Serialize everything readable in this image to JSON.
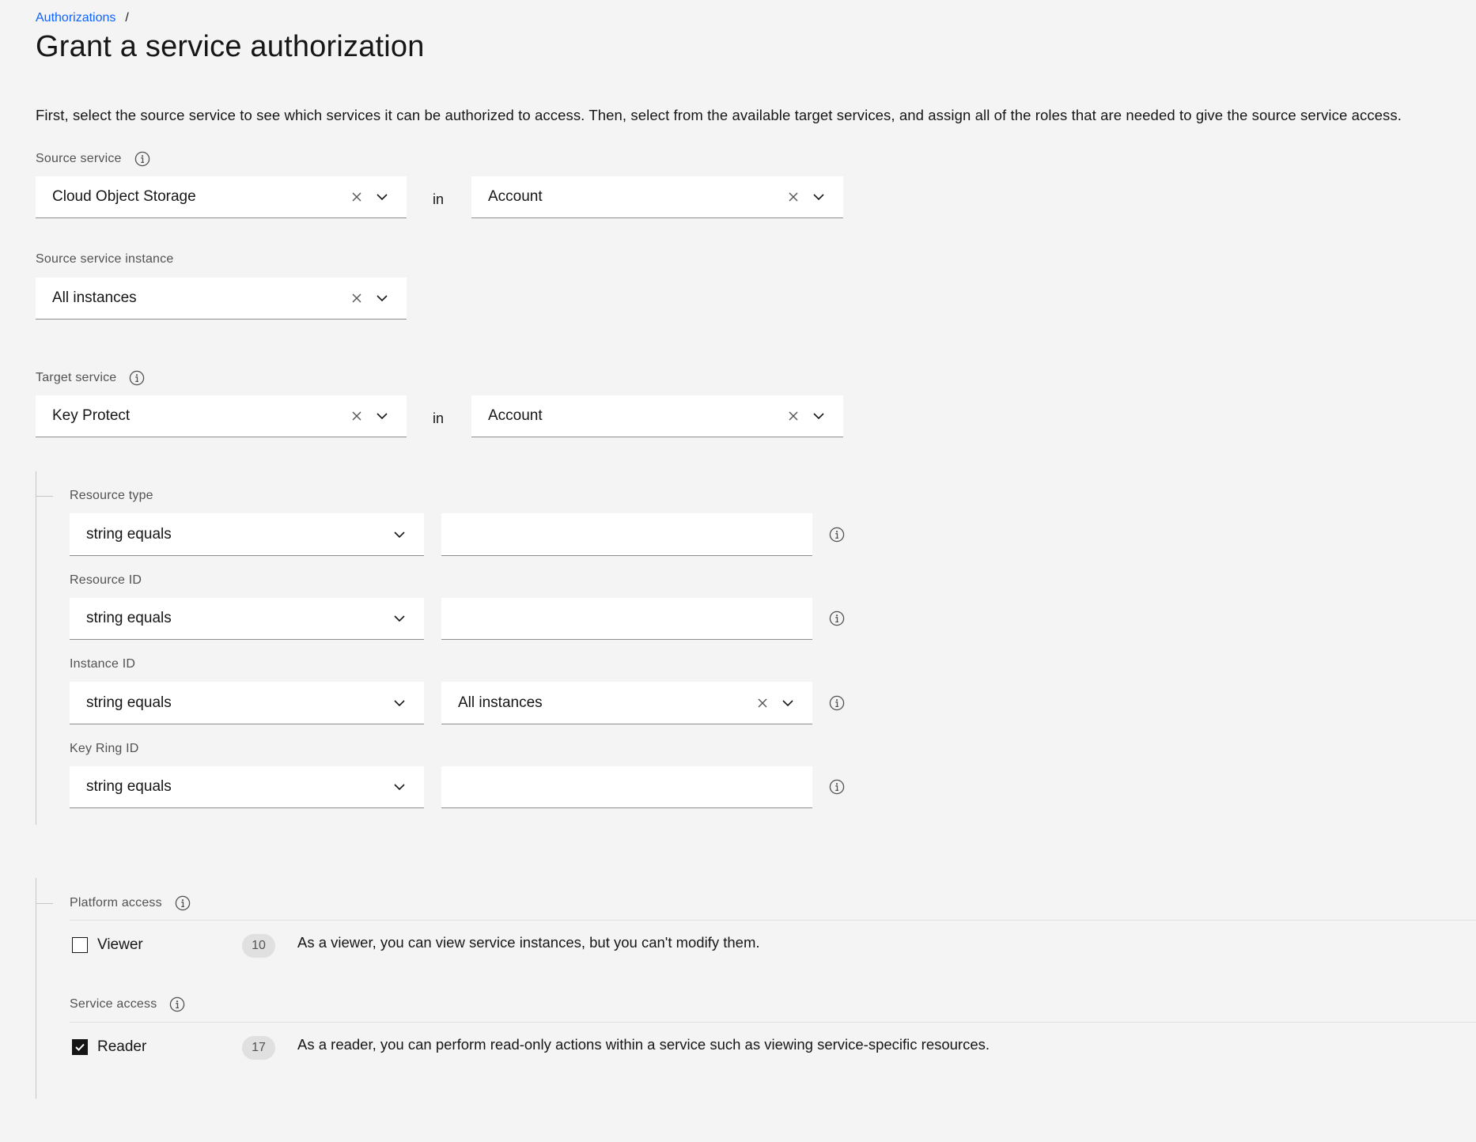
{
  "breadcrumb": {
    "link": "Authorizations",
    "separator": "/"
  },
  "page": {
    "title": "Grant a service authorization",
    "intro": "First, select the source service to see which services it can be authorized to access. Then, select from the available target services, and assign all of the roles that are needed to give the source service access."
  },
  "source": {
    "label": "Source service",
    "service_value": "Cloud Object Storage",
    "in_label": "in",
    "scope_value": "Account",
    "instance_label": "Source service instance",
    "instance_value": "All instances"
  },
  "target": {
    "label": "Target service",
    "service_value": "Key Protect",
    "in_label": "in",
    "scope_value": "Account"
  },
  "attributes": [
    {
      "label": "Resource type",
      "operator": "string equals",
      "value": ""
    },
    {
      "label": "Resource ID",
      "operator": "string equals",
      "value": ""
    },
    {
      "label": "Instance ID",
      "operator": "string equals",
      "value": "All instances"
    },
    {
      "label": "Key Ring ID",
      "operator": "string equals",
      "value": ""
    }
  ],
  "platform_access": {
    "label": "Platform access",
    "roles": [
      {
        "name": "Viewer",
        "count": "10",
        "checked": false,
        "description": "As a viewer, you can view service instances, but you can't modify them."
      }
    ]
  },
  "service_access": {
    "label": "Service access",
    "roles": [
      {
        "name": "Reader",
        "count": "17",
        "checked": true,
        "description": "As a reader, you can perform read-only actions within a service such as viewing service-specific resources."
      }
    ]
  },
  "icons": {
    "info": "info-icon",
    "clear": "close-icon",
    "chevron": "chevron-down-icon",
    "check": "checkmark-icon"
  },
  "colors": {
    "link": "#0f62fe",
    "background": "#f4f4f4",
    "field": "#ffffff",
    "text": "#161616"
  }
}
